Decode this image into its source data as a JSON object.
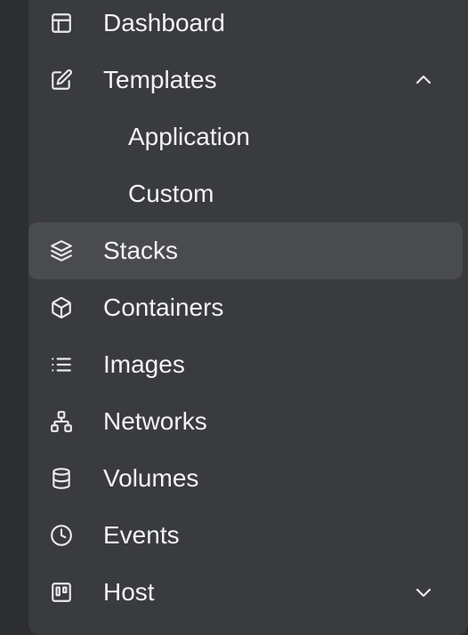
{
  "sidebar": {
    "items": [
      {
        "label": "Dashboard",
        "icon": "layout-icon"
      },
      {
        "label": "Templates",
        "icon": "edit-icon",
        "expanded": true
      },
      {
        "label": "Application"
      },
      {
        "label": "Custom"
      },
      {
        "label": "Stacks",
        "icon": "layers-icon",
        "active": true
      },
      {
        "label": "Containers",
        "icon": "box-icon"
      },
      {
        "label": "Images",
        "icon": "list-icon"
      },
      {
        "label": "Networks",
        "icon": "network-icon"
      },
      {
        "label": "Volumes",
        "icon": "database-icon"
      },
      {
        "label": "Events",
        "icon": "clock-icon"
      },
      {
        "label": "Host",
        "icon": "host-icon",
        "expanded": false
      }
    ]
  },
  "colors": {
    "background": "#2b2d31",
    "panel": "#3a3b3f",
    "active_item": "#4a4b4f",
    "text": "#f2f3f5",
    "icon": "#e8e9eb"
  }
}
